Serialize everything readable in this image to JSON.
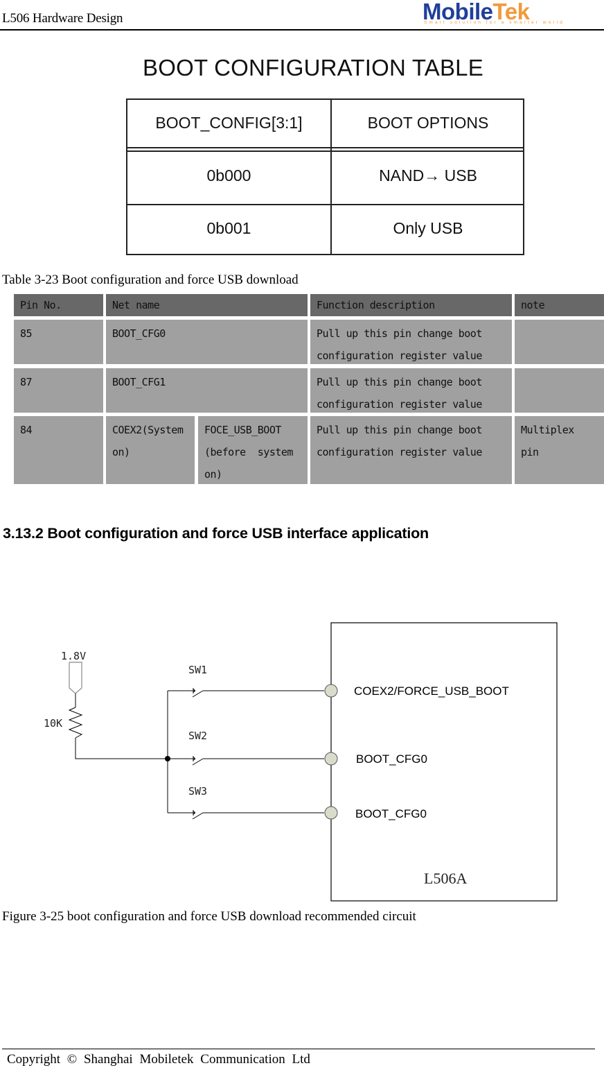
{
  "header": {
    "doc_title": "L506 Hardware Design",
    "logo": {
      "brand_part1": "M",
      "brand_part2": "obile",
      "brand_part3": "Tek",
      "tagline": "Smart solution for a smarter world",
      "colors": {
        "blue": "#1f3f9a",
        "orange": "#f29a3b"
      }
    }
  },
  "boot_config_figure": {
    "title": "BOOT CONFIGURATION TABLE",
    "headers": [
      "BOOT_CONFIG[3:1]",
      "BOOT OPTIONS"
    ],
    "rows": [
      [
        "0b000",
        "NAND→ USB"
      ],
      [
        "0b001",
        "Only USB"
      ]
    ]
  },
  "table": {
    "caption": "Table 3-23 Boot configuration and force USB download",
    "headers": [
      "Pin No.",
      "Net name",
      "Function description",
      "note"
    ],
    "rows": [
      {
        "pin": "85",
        "net": "BOOT_CFG0",
        "net2": "",
        "func": "Pull up this pin change boot configuration register value",
        "note": ""
      },
      {
        "pin": "87",
        "net": "BOOT_CFG1",
        "net2": "",
        "func": "Pull up this pin change boot configuration register value",
        "note": ""
      },
      {
        "pin": "84",
        "net": "COEX2(System on)",
        "net2": "FOCE_USB_BOOT (before  system on)",
        "func": "Pull up this pin change boot configuration register value",
        "note": "Multiplex pin"
      }
    ],
    "colors": {
      "header_bg": "#686868",
      "cell_bg": "#a0a0a0"
    }
  },
  "section": {
    "heading": "3.13.2 Boot configuration and force USB interface application"
  },
  "schematic": {
    "supply_label": "1.8V",
    "resistor_label": "10K",
    "switches": [
      "SW1",
      "SW2",
      "SW3"
    ],
    "pins": [
      "COEX2/FORCE_USB_BOOT",
      "BOOT_CFG0",
      "BOOT_CFG0"
    ],
    "chip_label": "L506A",
    "pin_fill": "#d9dccb"
  },
  "figure_caption": "Figure 3-25 boot configuration and force USB download recommended circuit",
  "footer": {
    "copyright": "Copyright  ©  Shanghai  Mobiletek  Communication  Ltd"
  }
}
